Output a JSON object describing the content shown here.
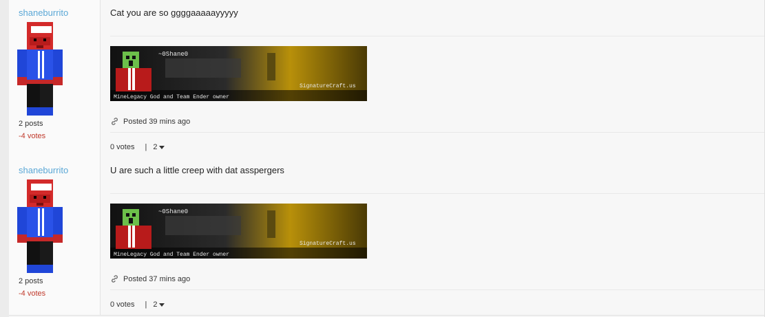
{
  "posts": [
    {
      "username": "shaneburrito",
      "post_count": "2 posts",
      "votes": "-4 votes",
      "message": "Cat you are so ggggaaaaayyyyy",
      "signature": {
        "name": "~0Shane0",
        "tagline": "MineLegacy God and Team Ender owner",
        "brand": "SignatureCraft.us"
      },
      "posted": "Posted 39 mins ago",
      "vote_label": "0 votes",
      "reply_count": "2"
    },
    {
      "username": "shaneburrito",
      "post_count": "2 posts",
      "votes": "-4 votes",
      "message": "U are such a little creep with dat asspergers",
      "signature": {
        "name": "~0Shane0",
        "tagline": "MineLegacy God and Team Ender owner",
        "brand": "SignatureCraft.us"
      },
      "posted": "Posted 37 mins ago",
      "vote_label": "0 votes",
      "reply_count": "2"
    }
  ],
  "icons": {
    "link": "link-icon",
    "caret": "chevron-down-icon"
  },
  "colors": {
    "username": "#5aa7d6",
    "negative_votes": "#c0392b"
  }
}
